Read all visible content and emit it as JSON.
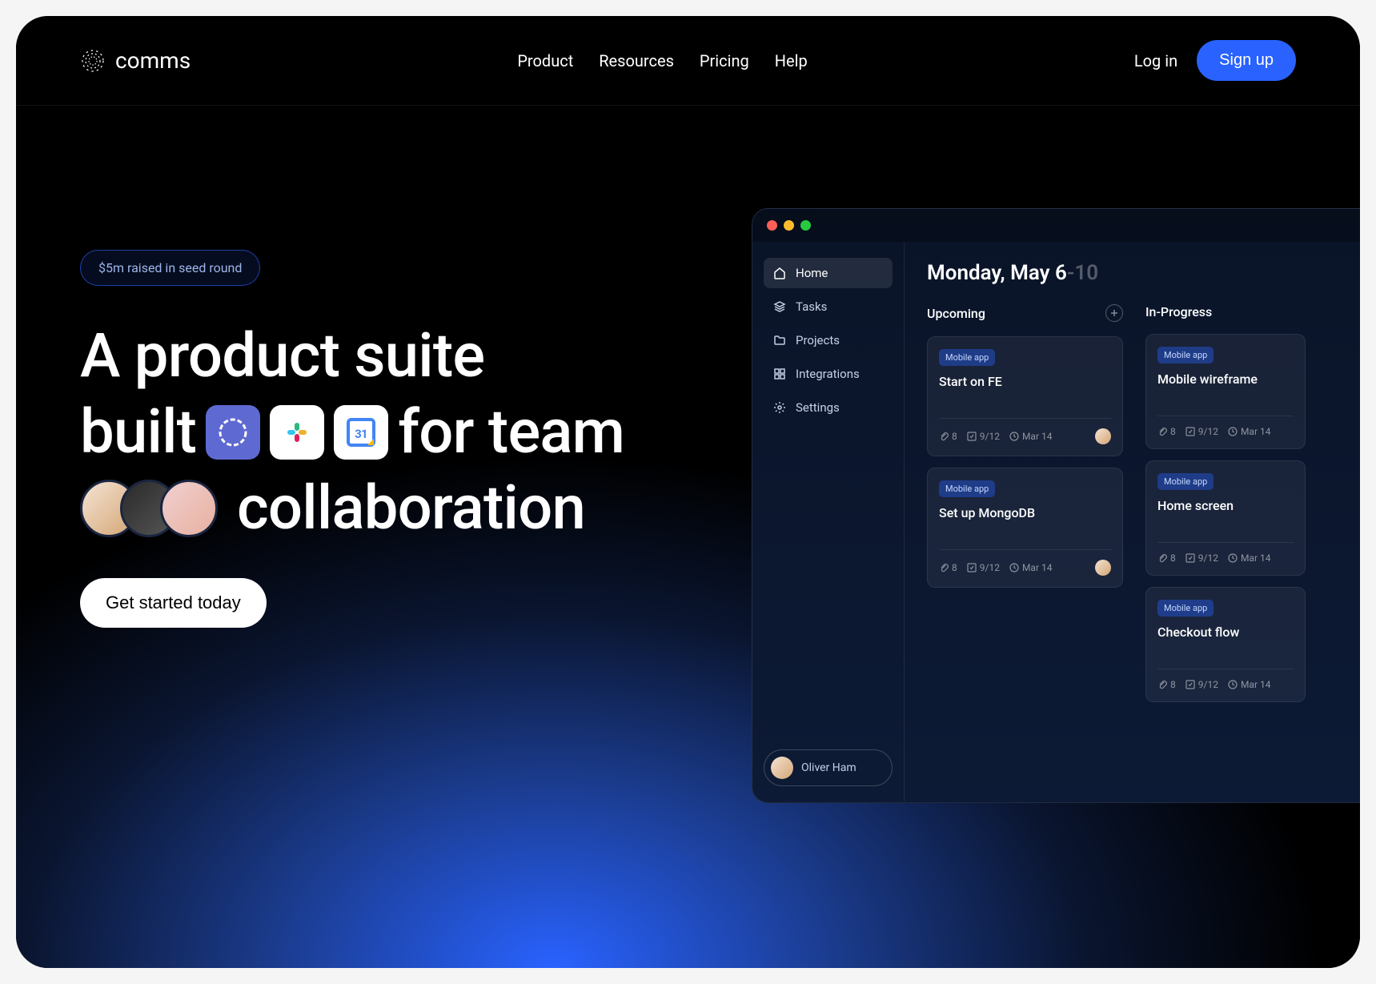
{
  "brand": "comms",
  "nav": {
    "items": [
      "Product",
      "Resources",
      "Pricing",
      "Help"
    ]
  },
  "auth": {
    "login": "Log in",
    "signup": "Sign up"
  },
  "hero": {
    "badge": "$5m raised in seed round",
    "title_line1": "A product suite",
    "title_line2_a": "built",
    "title_line2_b": "for team",
    "title_line3": "collaboration",
    "cta": "Get started today"
  },
  "app": {
    "sidebar": {
      "items": [
        "Home",
        "Tasks",
        "Projects",
        "Integrations",
        "Settings"
      ],
      "user": "Oliver Ham"
    },
    "date": {
      "main": "Monday, May 6",
      "range": "-10"
    },
    "columns": [
      {
        "title": "Upcoming",
        "cards": [
          {
            "tag": "Mobile app",
            "title": "Start on FE",
            "attachments": "8",
            "progress": "9/12",
            "due": "Mar 14"
          },
          {
            "tag": "Mobile app",
            "title": "Set up MongoDB",
            "attachments": "8",
            "progress": "9/12",
            "due": "Mar 14"
          }
        ]
      },
      {
        "title": "In-Progress",
        "cards": [
          {
            "tag": "Mobile app",
            "title": "Mobile wireframe",
            "attachments": "8",
            "progress": "9/12",
            "due": "Mar 14"
          },
          {
            "tag": "Mobile app",
            "title": "Home screen",
            "attachments": "8",
            "progress": "9/12",
            "due": "Mar 14"
          },
          {
            "tag": "Mobile app",
            "title": "Checkout flow",
            "attachments": "8",
            "progress": "9/12",
            "due": "Mar 14"
          }
        ]
      }
    ]
  }
}
